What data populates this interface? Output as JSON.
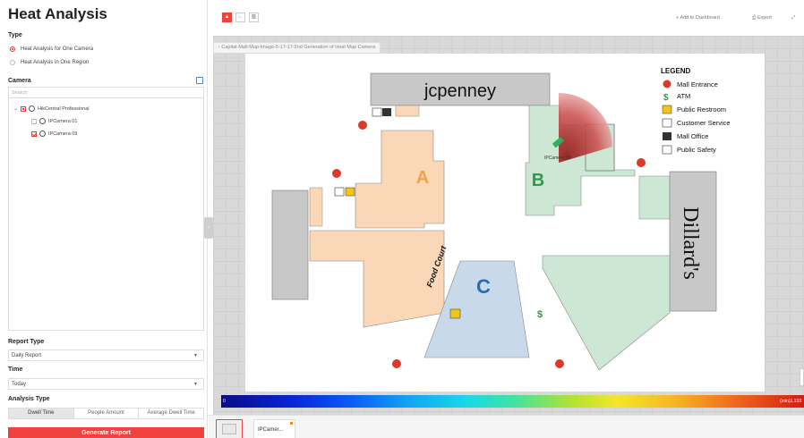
{
  "left": {
    "title": "Heat Analysis",
    "type_label": "Type",
    "type_options": [
      "Heat Analysis for One Camera",
      "Heat Analysis in One Region"
    ],
    "camera_label": "Camera",
    "search_placeholder": "Search",
    "tree": {
      "root": "HikCentral Professional",
      "cameras": [
        "IPCamera 01",
        "IPCamera 09"
      ]
    },
    "report_type_label": "Report Type",
    "report_type_value": "Daily Report",
    "time_label": "Time",
    "time_value": "Today",
    "analysis_type_label": "Analysis Type",
    "analysis_types": [
      "Dwell Time",
      "People Amount",
      "Average Dwell Time"
    ],
    "generate_label": "Generate Report"
  },
  "toolbar": {
    "add_dashboard": "Add to Dashboard",
    "export": "Export"
  },
  "breadcrumb": "Capital-Mall-Map-Image-5-17-17-2nd Generation of Heat Map Camera",
  "map": {
    "store_jcpenney": "jcpenney",
    "store_dillards": "Dillard's",
    "zone_a": "A",
    "zone_b": "B",
    "zone_c": "C",
    "food_court": "Food Court",
    "camera_label": "IPCamera 09",
    "legend_title": "LEGEND",
    "legend": [
      "Mall Entrance",
      "ATM",
      "Public Restroom",
      "Customer Service",
      "Mall Office",
      "Public Safety"
    ],
    "colors": {
      "zone_orange": "#fad7b7",
      "zone_green": "#cce7d3",
      "zone_blue": "#c8d9ea",
      "store_gray": "#c8c8c8",
      "accent": "#f0423c"
    }
  },
  "colorbar": {
    "left": "0",
    "right": "(min)1.133"
  },
  "thumbs": {
    "tab_label": "IPCamer..."
  }
}
